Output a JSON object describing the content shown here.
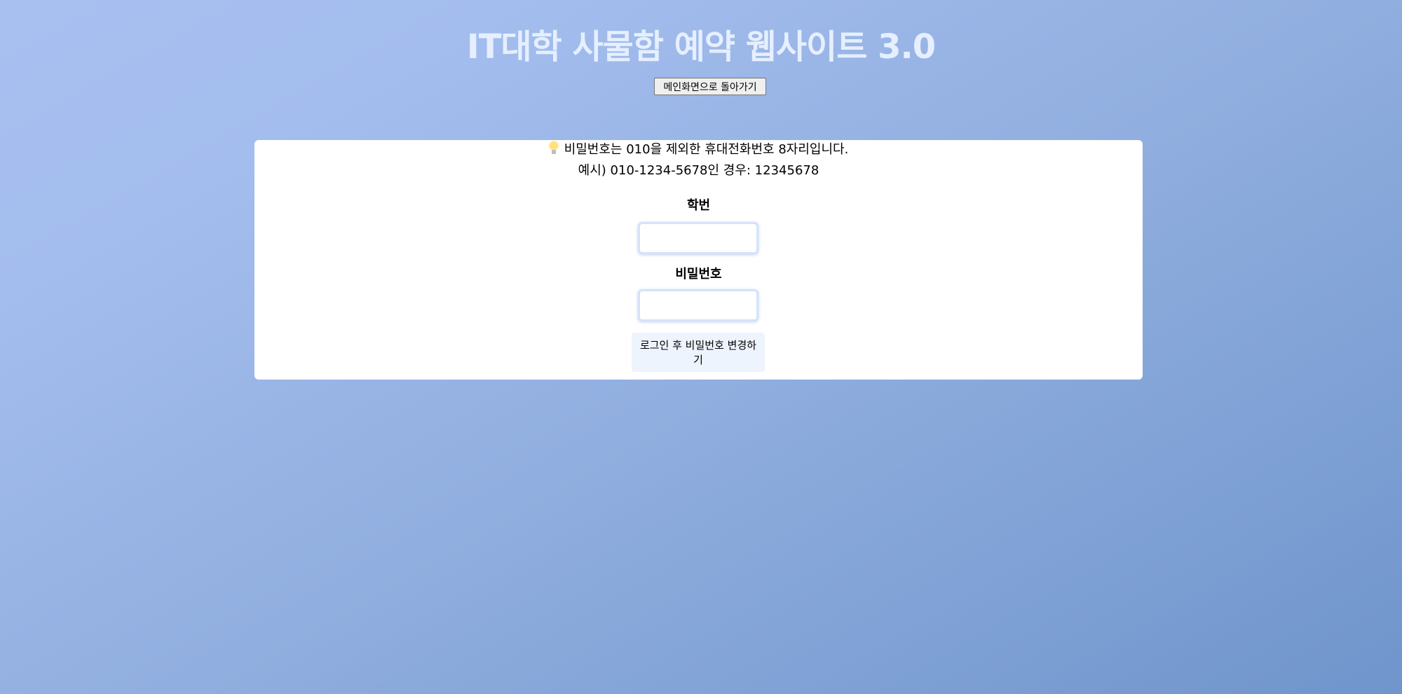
{
  "header": {
    "title": "IT대학 사물함 예약 웹사이트 3.0",
    "back_button_label": "메인화면으로 돌아가기"
  },
  "notice": {
    "icon": "lightbulb-icon",
    "line1": "비밀번호는 010을 제외한 휴대전화번호 8자리입니다.",
    "line2": "예시) 010-1234-5678인 경우: 12345678"
  },
  "form": {
    "student_id_label": "학번",
    "student_id_value": "",
    "password_label": "비밀번호",
    "password_value": "",
    "submit_label": "로그인 후 비밀번호 변경하기"
  }
}
